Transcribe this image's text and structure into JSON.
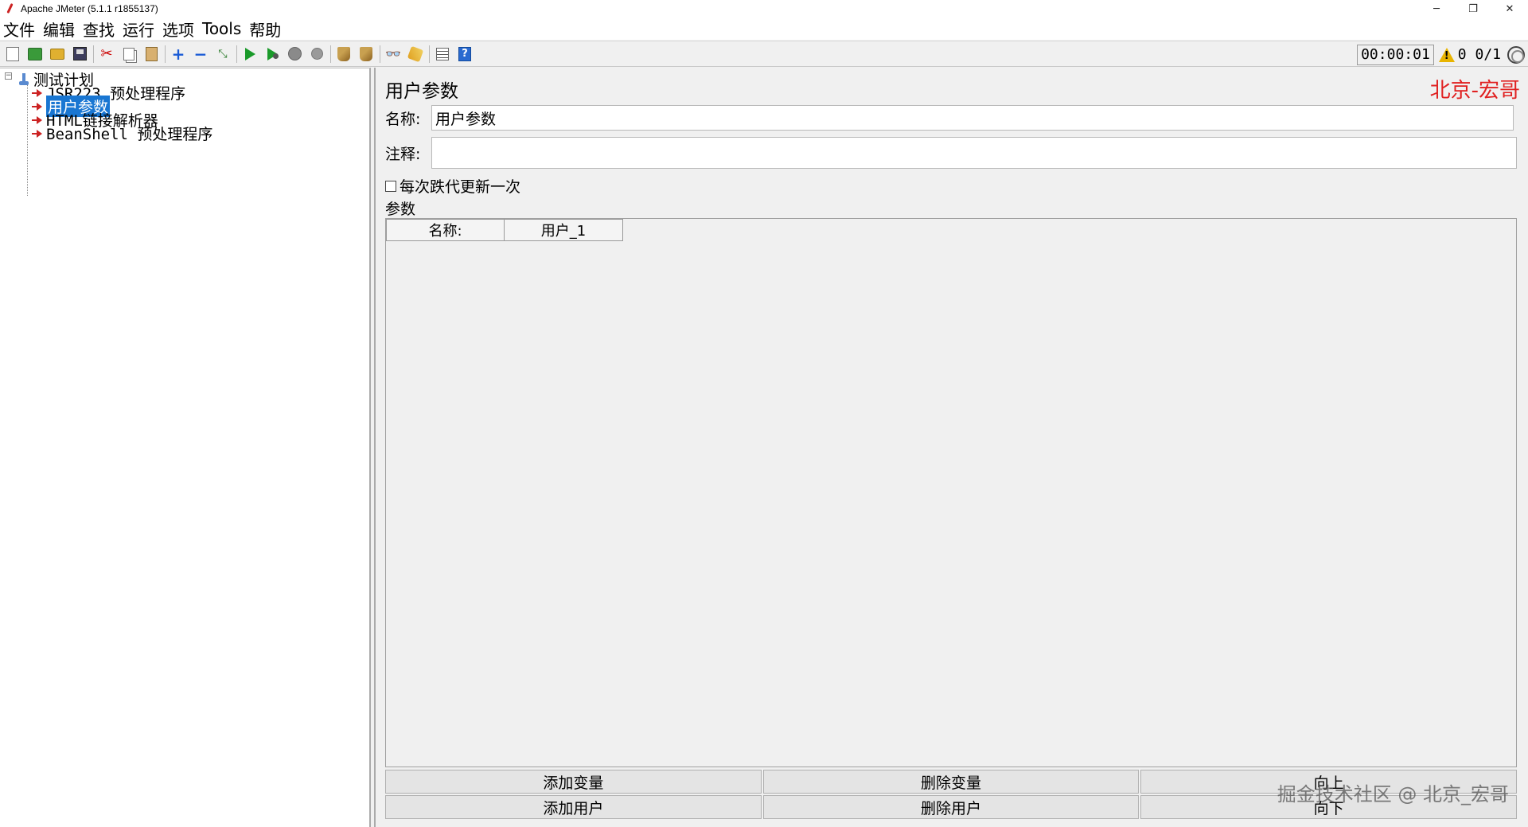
{
  "window": {
    "title": "Apache JMeter (5.1.1 r1855137)",
    "controls": {
      "minimize": "─",
      "restore": "❐",
      "close": "✕"
    }
  },
  "menu": [
    "文件",
    "编辑",
    "查找",
    "运行",
    "选项",
    "Tools",
    "帮助"
  ],
  "toolbar": {
    "timer": "00:00:01",
    "warning_count": "0",
    "threads": "0/1"
  },
  "tree": {
    "root": "测试计划",
    "items": [
      "JSR223 预处理程序",
      "用户参数",
      "HTML链接解析器",
      "BeanShell 预处理程序"
    ],
    "selected_index": 1
  },
  "panel": {
    "title": "用户参数",
    "brand": "北京-宏哥",
    "name_label": "名称:",
    "name_value": "用户参数",
    "comment_label": "注释:",
    "comment_value": "",
    "checkbox_label": "每次跌代更新一次",
    "checkbox_checked": false,
    "params_label": "参数",
    "columns": [
      "名称:",
      "用户_1"
    ],
    "buttons_row1": [
      "添加变量",
      "删除变量",
      "向上"
    ],
    "buttons_row2": [
      "添加用户",
      "删除用户",
      "向下"
    ],
    "watermark": "掘金技术社区 @ 北京_宏哥"
  }
}
